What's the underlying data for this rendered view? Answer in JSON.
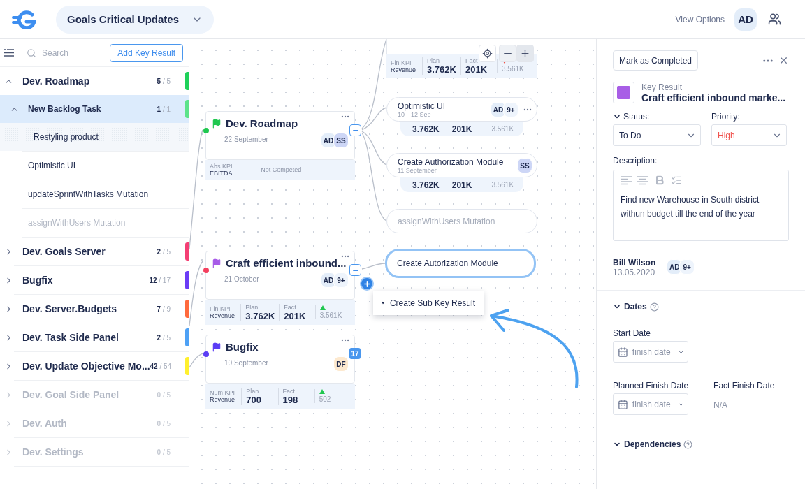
{
  "header": {
    "workspace": "Goals Critical Updates",
    "view_options": "View Options",
    "user_initials": "AD"
  },
  "sidebar": {
    "search_placeholder": "Search",
    "add_button": "Add Key Result",
    "items": [
      {
        "name": "Dev. Roadmap",
        "done": "5",
        "total": "/ 5",
        "color": "#1fd15a",
        "expanded": true,
        "disabled": false,
        "children": [
          {
            "name": "New Backlog Task",
            "done": "1",
            "total": "/ 1",
            "color": "#5de38a",
            "expanded": true,
            "highlighted": true,
            "selected": false,
            "disabled": false,
            "children": [
              {
                "name": "Restyling product",
                "highlighted": false,
                "selected": true,
                "disabled": false
              }
            ]
          },
          {
            "name": "Optimistic UI",
            "highlighted": false,
            "selected": false,
            "disabled": false
          },
          {
            "name": "updateSprintWithTasks Mutation",
            "highlighted": false,
            "selected": false,
            "disabled": false
          },
          {
            "name": "assignWithUsers Mutation",
            "highlighted": false,
            "selected": false,
            "disabled": true
          }
        ]
      },
      {
        "name": "Dev. Goals Server",
        "done": "2",
        "total": "/ 5",
        "color": "#f43f74",
        "expanded": false,
        "disabled": false
      },
      {
        "name": "Bugfix",
        "done": "12",
        "total": "/ 17",
        "color": "#6b3cf6",
        "expanded": false,
        "disabled": false
      },
      {
        "name": "Dev. Server.Budgets",
        "done": "7",
        "total": "/ 9",
        "color": "#ff6a3d",
        "expanded": false,
        "disabled": false
      },
      {
        "name": "Dev. Task Side Panel",
        "done": "2",
        "total": "/ 5",
        "color": "#4ea1f5",
        "expanded": false,
        "disabled": false
      },
      {
        "name": "Dev. Update Objective Mo...",
        "done": "42",
        "total": "/ 54",
        "color": "#fff02e",
        "expanded": false,
        "disabled": false
      },
      {
        "name": "Dev. Goal Side Panel",
        "done": "0",
        "total": "/ 5",
        "expanded": false,
        "disabled": true
      },
      {
        "name": "Dev. Auth",
        "done": "0",
        "total": "/ 5",
        "expanded": false,
        "disabled": true
      },
      {
        "name": "Dev. Settings",
        "done": "0",
        "total": "/ 5",
        "expanded": false,
        "disabled": true
      }
    ]
  },
  "canvas": {
    "top_card": {
      "kpi": {
        "kind": "metrics",
        "type": "Fin KPI",
        "metric": "Revenue",
        "plan_label": "Plan",
        "plan": "3.762K",
        "fact_label": "Fact",
        "fact": "201K",
        "rising": false,
        "forecast": "3.561K"
      }
    },
    "cards": [
      {
        "title": "Dev. Roadmap",
        "flag": {
          "color": "#1fc74f"
        },
        "dot": {
          "color": "#1fc74f"
        },
        "date": "22 September",
        "expanded": true,
        "avatars": [
          {
            "initials": "AD",
            "color": "#e3edf9"
          },
          {
            "initials": "SS",
            "color": "#cdd6f6"
          }
        ],
        "kpi": {
          "kind": "status",
          "type": "Abs KPI",
          "metric": "EBITDA",
          "status": "Not Competed"
        }
      },
      {
        "title": "Craft efficient inbound...",
        "flag": {
          "color": "#a75ae8"
        },
        "dot": {
          "color": "#f43f5e"
        },
        "date": "21 October",
        "expanded": true,
        "avatars": [
          {
            "initials": "AD",
            "color": "#e3edf9"
          },
          {
            "initials": "9+",
            "color": "#eef4fc"
          }
        ],
        "kpi": {
          "kind": "metrics",
          "type": "Fin KPI",
          "metric": "Revenue",
          "plan_label": "Plan",
          "plan": "3.762K",
          "fact_label": "Fact",
          "fact": "201K",
          "rising": true,
          "forecast": "3.561K"
        }
      },
      {
        "title": "Bugfix",
        "flag": {
          "color": "#5b3df5"
        },
        "dot": {
          "color": "#5b3df5"
        },
        "date": "10 September",
        "expanded": false,
        "hidden_count": "17",
        "avatars": [
          {
            "initials": "DF",
            "color": "#fde9cf"
          }
        ],
        "kpi": {
          "kind": "metrics",
          "type": "Num KPI",
          "metric": "Revenue",
          "plan_label": "Plan",
          "plan": "700",
          "fact_label": "Fact",
          "fact": "198",
          "rising": true,
          "forecast": "502"
        }
      }
    ],
    "sub_nodes": [
      {
        "title": "Optimistic UI",
        "date": "10—12 Sep",
        "more": true,
        "selected": false,
        "disabled": false,
        "avatars": [
          {
            "initials": "AD",
            "color": "#e3edf9"
          },
          {
            "initials": "9+",
            "color": "#eef4fc"
          }
        ],
        "kpi": {
          "plan": "3.762K",
          "fact": "201K",
          "forecast": "3.561K"
        }
      },
      {
        "title": "Create Authorization Module",
        "date": "11 September",
        "more": false,
        "selected": false,
        "disabled": false,
        "avatars": [
          {
            "initials": "SS",
            "color": "#cdd6f6"
          }
        ],
        "kpi": {
          "plan": "3.762K",
          "fact": "201K",
          "forecast": "3.561K"
        }
      },
      {
        "title": "assignWithUsers Mutation",
        "more": false,
        "selected": false,
        "disabled": true
      },
      {
        "title": "Create Autorization Module",
        "more": false,
        "selected": true,
        "disabled": false
      }
    ],
    "menu": {
      "label": "Create Sub Key Result"
    }
  },
  "panel": {
    "mark_button": "Mark as Completed",
    "swatch": {
      "color": "#a85ee6"
    },
    "type_label": "Key Result",
    "title": "Craft efficient inbound marke...",
    "status_label": "Status:",
    "status": "To Do",
    "priority_label": "Priority:",
    "priority": {
      "value": "High",
      "kind": "high"
    },
    "description_label": "Description:",
    "description": "Find new Warehouse in South district withun budget till the end of the year",
    "owner": "Bill Wilson",
    "owner_date": "13.05.2020",
    "avatars": [
      {
        "initials": "AD",
        "color": "#e3edf9"
      },
      {
        "initials": "9+",
        "color": "#eef4fc"
      }
    ],
    "dates": {
      "title": "Dates",
      "start_label": "Start Date",
      "start_placeholder": "finish date",
      "planned_label": "Planned Finish Date",
      "planned_placeholder": "finish date",
      "fact_label": "Fact Finish Date",
      "fact_value": "N/A"
    },
    "dependencies": {
      "title": "Dependencies"
    }
  }
}
